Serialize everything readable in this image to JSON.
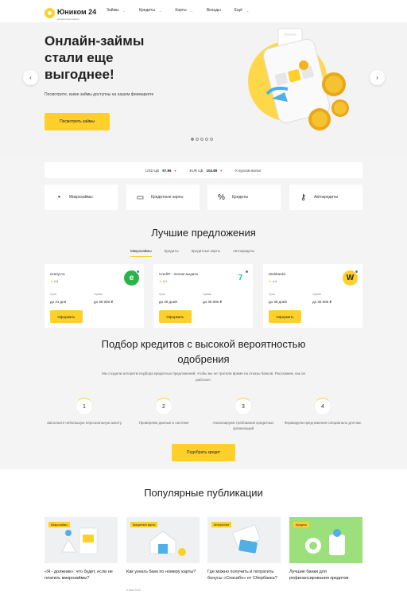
{
  "header": {
    "logo_name": "Юником 24",
    "logo_sub": "финансовый маркет",
    "nav": [
      {
        "label": "Займы"
      },
      {
        "label": "Кредиты"
      },
      {
        "label": "Карты"
      },
      {
        "label": "Вклады"
      },
      {
        "label": "Ещё"
      }
    ]
  },
  "hero": {
    "title": "Онлайн-займы стали еще выгоднее!",
    "description": "Посмотрите, какие займы доступны на нашем финмаркете",
    "button": "Посмотреть займы",
    "prev": "‹",
    "next": "›",
    "slides_count": 5,
    "active_slide": 1
  },
  "rates": {
    "usd_label": "USD ЦБ",
    "usd_value": "97.96",
    "usd_trend": "down",
    "eur_label": "EUR ЦБ",
    "eur_value": "104.89",
    "eur_trend": "down",
    "link": "К курсам валют"
  },
  "categories": [
    {
      "label": "Микрозаймы",
      "icon": "clock-coin-icon"
    },
    {
      "label": "Кредитные карты",
      "icon": "credit-card-icon"
    },
    {
      "label": "Кредиты",
      "icon": "percent-icon"
    },
    {
      "label": "Автокредиты",
      "icon": "car-key-icon"
    }
  ],
  "offers": {
    "title": "Лучшие предложения",
    "tabs": [
      "Микрозаймы",
      "Кредиты",
      "Кредитные карты",
      "Автокредиты"
    ],
    "active_tab": 0,
    "term_label": "Срок",
    "sum_label": "Сумма",
    "button": "Оформить",
    "items": [
      {
        "name": "екапуста",
        "rating": "4,8",
        "term": "до 21 дня",
        "sum": "до 30 000 ₽",
        "logo_color": "#2bb34a",
        "logo_glyph": "e"
      },
      {
        "name": "Credit7 - легкая выдача",
        "rating": "4,1",
        "term": "до 30 дней",
        "sum": "до 30 000 ₽",
        "logo_color": "#19c3a8",
        "logo_glyph": "7"
      },
      {
        "name": "Webbankir",
        "rating": "4,4",
        "term": "до 30 дней",
        "sum": "до 30 000 ₽",
        "logo_color": "#ffd02a",
        "logo_glyph": "W"
      }
    ]
  },
  "selection": {
    "title": "Подбор кредитов с высокой вероятностью одобрения",
    "description": "Мы создали алгоритм подбора кредитных предложений, чтобы вы не тратили время на отказы банков. Расскажем, как он работает.",
    "steps": [
      {
        "num": "1",
        "text": "Заполните небольшую персональную анкету"
      },
      {
        "num": "2",
        "text": "Проверяем данные в системе"
      },
      {
        "num": "3",
        "text": "Анализируем требования кредитных организаций"
      },
      {
        "num": "4",
        "text": "Формируем предложения специально для вас"
      }
    ],
    "button": "Подобрать кредит"
  },
  "publications": {
    "title": "Популярные публикации",
    "items": [
      {
        "tag": "Микрозаймы",
        "title": "«Я - должник»: что будет, если не платить микрозаймы?",
        "date": "",
        "bg": "#eef0f2"
      },
      {
        "tag": "Кредитные карты",
        "title": "Как узнать банк по номеру карты?",
        "date": "6 мая 2022",
        "bg": "#eef0f2"
      },
      {
        "tag": "Интересное",
        "title": "Где можно получить и потратить бонусы «Спасибо» от Сбербанка?",
        "date": "",
        "bg": "#eef0f2"
      },
      {
        "tag": "Кредиты",
        "title": "Лучшие банки для рефинансирования кредитов",
        "date": "",
        "bg": "#9be07a"
      }
    ]
  },
  "colors": {
    "accent": "#ffd02a",
    "page_bg": "#f4f4f4",
    "down": "#e44444"
  }
}
